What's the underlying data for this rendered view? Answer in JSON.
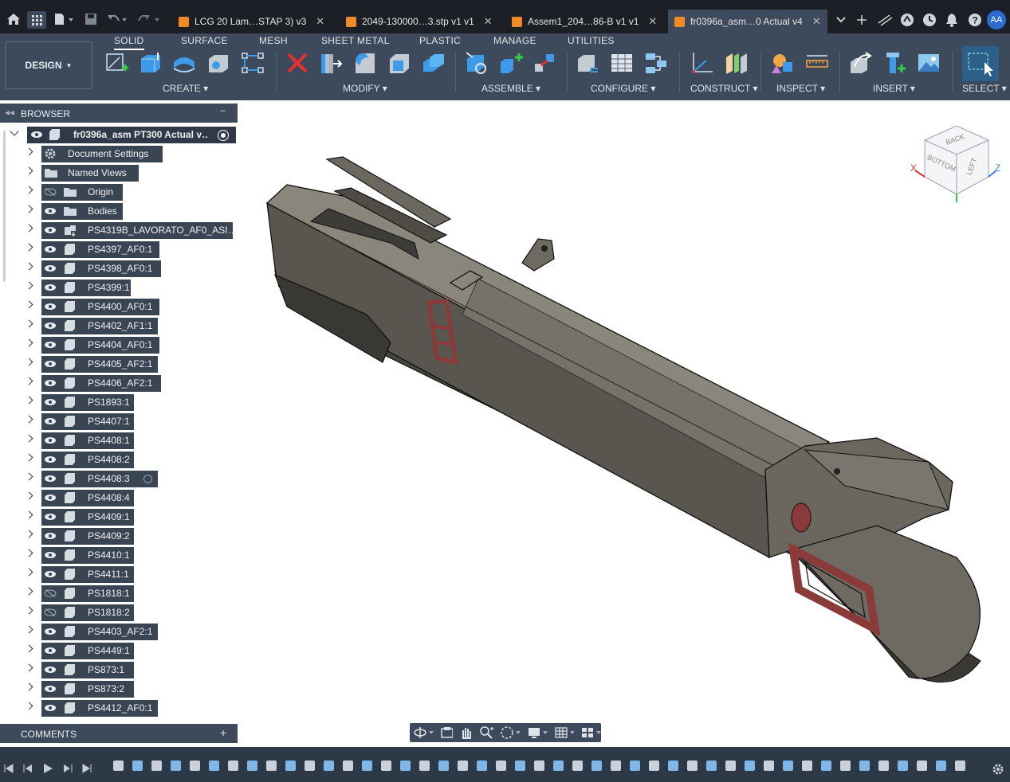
{
  "tabs": [
    {
      "label": "LCG 20 Lam…STAP 3) v3"
    },
    {
      "label": "2049-130000…3.stp v1 v1"
    },
    {
      "label": "Assem1_204…86-B v1 v1"
    },
    {
      "label": "fr0396a_asm…0 Actual v4"
    }
  ],
  "user_initials": "AA",
  "workspace": {
    "label": "DESIGN"
  },
  "ribbon_tabs": [
    "SOLID",
    "SURFACE",
    "MESH",
    "SHEET METAL",
    "PLASTIC",
    "MANAGE",
    "UTILITIES"
  ],
  "ribbon_groups": [
    "CREATE",
    "MODIFY",
    "ASSEMBLE",
    "CONFIGURE",
    "CONSTRUCT",
    "INSPECT",
    "INSERT",
    "SELECT"
  ],
  "browser": {
    "title": "BROWSER",
    "root": "fr0396a_asm PT300 Actual v…",
    "items": [
      {
        "label": "Document Settings",
        "kind": "settings"
      },
      {
        "label": "Named Views",
        "kind": "folder"
      },
      {
        "label": "Origin",
        "kind": "folder",
        "hidden": true
      },
      {
        "label": "Bodies",
        "kind": "folder"
      },
      {
        "label": "PS4319B_LAVORATO_AF0_ASI…",
        "kind": "assembly"
      },
      {
        "label": "PS4397_AF0:1",
        "kind": "component"
      },
      {
        "label": "PS4398_AF0:1",
        "kind": "component"
      },
      {
        "label": "PS4399:1",
        "kind": "component"
      },
      {
        "label": "PS4400_AF0:1",
        "kind": "component"
      },
      {
        "label": "PS4402_AF1:1",
        "kind": "component"
      },
      {
        "label": "PS4404_AF0:1",
        "kind": "component"
      },
      {
        "label": "PS4405_AF2:1",
        "kind": "component"
      },
      {
        "label": "PS4406_AF2:1",
        "kind": "component"
      },
      {
        "label": "PS1893:1",
        "kind": "component"
      },
      {
        "label": "PS4407:1",
        "kind": "component"
      },
      {
        "label": "PS4408:1",
        "kind": "component"
      },
      {
        "label": "PS4408:2",
        "kind": "component"
      },
      {
        "label": "PS4408:3",
        "kind": "component"
      },
      {
        "label": "PS4408:4",
        "kind": "component"
      },
      {
        "label": "PS4409:1",
        "kind": "component"
      },
      {
        "label": "PS4409:2",
        "kind": "component"
      },
      {
        "label": "PS4410:1",
        "kind": "component"
      },
      {
        "label": "PS4411:1",
        "kind": "component"
      },
      {
        "label": "PS1818:1",
        "kind": "component",
        "hidden": true
      },
      {
        "label": "PS1818:2",
        "kind": "component",
        "hidden": true
      },
      {
        "label": "PS4403_AF2:1",
        "kind": "component"
      },
      {
        "label": "PS4449:1",
        "kind": "component"
      },
      {
        "label": "PS873:1",
        "kind": "component"
      },
      {
        "label": "PS873:2",
        "kind": "component"
      },
      {
        "label": "PS4412_AF0:1",
        "kind": "component"
      }
    ]
  },
  "comments": {
    "title": "COMMENTS"
  },
  "viewcube": {
    "faces": [
      "BACK",
      "BOTTOM",
      "LEFT"
    ],
    "axes": [
      "X",
      "Y",
      "Z"
    ]
  },
  "colors": {
    "accent": "#0696d7",
    "tab_active": "#3c4a5c",
    "model_body": "#6e6a62",
    "model_red": "#8b3a3a"
  }
}
